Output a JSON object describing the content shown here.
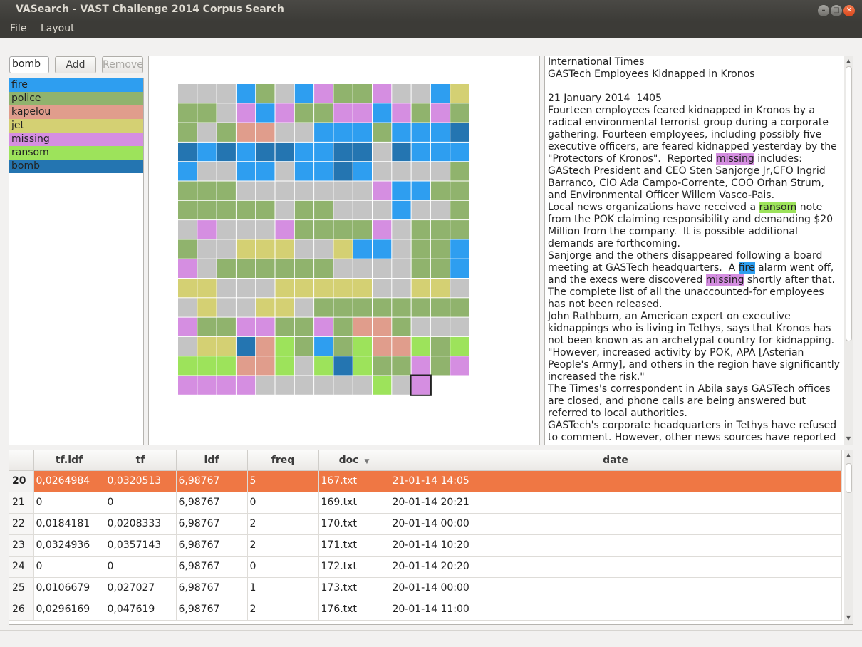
{
  "window": {
    "title": "VASearch - VAST Challenge 2014 Corpus Search"
  },
  "menu": {
    "file": "File",
    "layout": "Layout"
  },
  "search": {
    "value": "bomb",
    "add_label": "Add",
    "remove_label": "Remove"
  },
  "terms": [
    {
      "label": "fire",
      "color": "#2e9ef0"
    },
    {
      "label": "police",
      "color": "#90b36d"
    },
    {
      "label": "kapelou",
      "color": "#e09d8c"
    },
    {
      "label": "jet",
      "color": "#d4d073"
    },
    {
      "label": "missing",
      "color": "#d58ee1"
    },
    {
      "label": "ransom",
      "color": "#9de35b"
    },
    {
      "label": "bomb",
      "color": "#2475b1"
    }
  ],
  "document": {
    "publisher": "International Times",
    "headline": "GASTech Employees Kidnapped in Kronos",
    "dateline": "21 January 2014  1405",
    "paragraphs": [
      [
        {
          "t": "Fourteen employees feared kidnapped in Kronos by a radical environmental terrorist group during a corporate gathering. Fourteen employees, including possibly five executive officers, are feared kidnapped yesterday by the \"Protectors of Kronos\".  Reported "
        },
        {
          "t": "missing",
          "h": "missing"
        },
        {
          "t": " includes: GAStech President and CEO Sten Sanjorge Jr,CFO Ingrid Barranco, CIO Ada Campo-Corrente, COO Orhan Strum, and Environmental Officer Willem Vasco-Pais."
        }
      ],
      [
        {
          "t": "Local news organizations have received a "
        },
        {
          "t": "ransom",
          "h": "ransom"
        },
        {
          "t": " note from the POK claiming responsibility and demanding $20 Million from the company.  It is possible additional demands are forthcoming."
        }
      ],
      [
        {
          "t": "Sanjorge and the others disappeared following a board meeting at GASTech headquarters.  A "
        },
        {
          "t": "fire",
          "h": "fire"
        },
        {
          "t": " alarm went off, and the execs were discovered "
        },
        {
          "t": "missing",
          "h": "missing"
        },
        {
          "t": " shortly after that.  The complete list of all the unaccounted-for employees has not been released."
        }
      ],
      [
        {
          "t": "John Rathburn, an American expert on executive kidnappings who is living in Tethys, says that Kronos has not been known as an archetypal country for kidnapping. \"However, increased activity by POK, APA [Asterian People's Army], and others in the region have significantly increased the risk.\""
        }
      ],
      [
        {
          "t": "The Times's correspondent in Abila says GASTech offices are closed, and phone calls are being answered but referred to local authorities."
        }
      ],
      [
        {
          "t": "GASTech's corporate headquarters in Tethys have refused to comment. However, other news sources have reported Tethys federal law enforcement officials and staff from the"
        }
      ]
    ]
  },
  "table": {
    "columns": [
      "tf.idf",
      "tf",
      "idf",
      "freq",
      "doc",
      "date"
    ],
    "rows": [
      {
        "num": "20",
        "tfidf": "0,0264984",
        "tf": "0,0320513",
        "idf": "6,98767",
        "freq": "5",
        "doc": "167.txt",
        "date": "21-01-14 14:05",
        "selected": true
      },
      {
        "num": "21",
        "tfidf": "0",
        "tf": "0",
        "idf": "6,98767",
        "freq": "0",
        "doc": "169.txt",
        "date": "20-01-14 20:21"
      },
      {
        "num": "22",
        "tfidf": "0,0184181",
        "tf": "0,0208333",
        "idf": "6,98767",
        "freq": "2",
        "doc": "170.txt",
        "date": "20-01-14 00:00"
      },
      {
        "num": "23",
        "tfidf": "0,0324936",
        "tf": "0,0357143",
        "idf": "6,98767",
        "freq": "2",
        "doc": "171.txt",
        "date": "20-01-14 10:20"
      },
      {
        "num": "24",
        "tfidf": "0",
        "tf": "0",
        "idf": "6,98767",
        "freq": "0",
        "doc": "172.txt",
        "date": "20-01-14 20:20"
      },
      {
        "num": "25",
        "tfidf": "0,0106679",
        "tf": "0,027027",
        "idf": "6,98767",
        "freq": "1",
        "doc": "173.txt",
        "date": "20-01-14 00:00"
      },
      {
        "num": "26",
        "tfidf": "0,0296169",
        "tf": "0,047619",
        "idf": "6,98767",
        "freq": "2",
        "doc": "176.txt",
        "date": "20-01-14 11:00"
      }
    ]
  },
  "doc_grid": {
    "empty_color": "#c4c4c4",
    "selected_doc": "167.txt",
    "rows": [
      "_ _ _ f p _ f m p p m _ _ f j",
      "p p _ m f m p p m m f m p m p",
      "p _ p k k _ _ f f f p f f f b",
      "b f b f b b f f b b _ b f f f",
      "f _ _ f f _ f f b f _ _ _ _ p",
      "p p p _ _ _ _ _ _ _ m f f p p",
      "p p p p p _ p p _ _ _ f _ _ p",
      "_ m _ _ _ m p p p p m _ p p p",
      "p _ _ j j j _ _ j f f _ p p f",
      "m _ p p p p p p _ _ _ _ p p f",
      "j j _ _ _ j j j j j _ _ j j _",
      "_ j _ _ j j _ p p p p p p p p",
      "m p p m m p p m p k k p _ _ _",
      "_ j j b k r p f p r k k r p r",
      "r r r k k r _ r b r p p m p m",
      "m m m m _ _ _ _ _ _ r _ m"
    ]
  }
}
